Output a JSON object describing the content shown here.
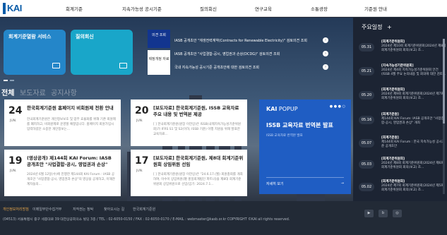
{
  "header": {
    "logo": "KAI",
    "nav": [
      "회계기준",
      "지속가능성 공시기준",
      "질의회신",
      "연구교육",
      "소통광장",
      "기준원 안내"
    ]
  },
  "tiles": [
    {
      "label": "회계기준열람 서비스"
    },
    {
      "label": "질의회신"
    }
  ],
  "consult": {
    "tab_active": "의견 조회",
    "tab_other": "제정개정 자료",
    "rows": [
      "IASB 공개초안 \"재생전력계약(Contracts for Renewable Electricity)\" 검토의견 조회",
      "IASB 공개초안 \"사업결합-공시, 영업권과 손상(DCDG)\" 검토의견 조회",
      "국내 지속가능성 공시기준 공개초안에 대한 검토의견 조회"
    ],
    "arrow": "›"
  },
  "sections": [
    "전체",
    "보도자료",
    "공지사항"
  ],
  "news": [
    {
      "day": "24",
      "month": "JUN.",
      "title": "한국회계기준원 홈페이지 비회원제 전환 안내",
      "body": "한국회계기준원은 개인정보보호 및 업무 효율화를 위해 기존 회원제를 폐지하고, 비회원제로 운영할 예정입니다. 홈페이지 회원가입시 입력하셨던 소중한 개인정보는..."
    },
    {
      "day": "20",
      "month": "JUN.",
      "title": "[보도자료] 한국회계기준원, ISSB 교육자료 주요 내용 및 번역본 제공",
      "body": "[ ] 한국회계기준원(원장 이한상)은 ISSB(국제지속가능성기준위원회)가 IFRS S1 및 S2(이하, ISSB 기준) 이행 지원을 위해 발표한 교육자료..."
    },
    {
      "day": "19",
      "month": "JUN.",
      "title": "(영상공개) 제144회 KAI Forum: IASB 공개초안 \"사업결합-공시, 영업권과 손상\"",
      "body": "2024년 6월 12일(수)에 진행한 제144회 KAI Forum : IASB 공개초안 \"사업결합-공시, 영업권과 손상\"의 영상을 공개하고, 이해관계자들의..."
    },
    {
      "day": "17",
      "month": "JUN.",
      "title": "[보도자료] 한국회계기준원, 제8대 회계기준위원회 상임위원 선임",
      "body": "[ ] 한국회계기준원(원장 이한상)은 \"24.6.17.(월) 회원총회를 개최하여, 이수이 상임위원(現 홍일회계법인 파트너)을 제8대 회계기준위원회 상임위원으로 선임(임기: 2024.7.1..."
    }
  ],
  "popup": {
    "brand": "KAI",
    "brand_suffix": "POPUP",
    "pages": "● ● ● ○",
    "title": "ISSB 교육자료 번역본 발표",
    "subtitle": "ISSB 교육자료 번역본 발표",
    "button": "자세히 보기",
    "arrow": "→"
  },
  "schedule": {
    "title": "주요일정",
    "plus": "+",
    "items": [
      {
        "date": "05.31",
        "title": "[회계기준위원회]",
        "body": "2024년 제10회 회계기준위원회(2024년 제8회 회계기준위원회 회의(보고) 조..."
      },
      {
        "date": "05.21",
        "title": "[지속가능성기준위원회]",
        "body": "2024년 제4회 지속가능성기준위원회 안건 (ISSB 4월 주요 논의내용 및 회의에 대한 검토..."
      },
      {
        "date": "05.20",
        "title": "[회계기준위원회]",
        "body": "2024년 제9회 회계기준위원회(2024년 제7회 회계기준위원회 회의(보고) 조..."
      },
      {
        "date": "05.16",
        "title": "[회계기준원]",
        "body": "제144회 KAI Forum: IASB 공개초안 \"사업결합-공시, 영업권과 손상\" 개최"
      },
      {
        "date": "05.07",
        "title": "[회계기준원]",
        "body": "제144회 KAI Forum : 한국 지속가능성 공시기준 공개초안"
      },
      {
        "date": "05.03",
        "title": "[회계기준위원회]",
        "body": "2024년 제8회 회계기준위원회(2024년 제6회 회계기준위원회 회의(보고) 조..."
      },
      {
        "date": "05.02",
        "title": "[회계기준위원회]",
        "body": "2024년 제7회 회계기준위원회(2024년 제5회 회계기준위원회 회의(보고) 조..."
      }
    ]
  },
  "footer": {
    "links": [
      "개인정보처리방침",
      "이메일무단수집거부",
      "저작권는 청탁",
      "찾아오시는 길",
      "한국회계기준원"
    ],
    "address": "(04513) 서울특별시 중구 세종대로 39 대한상공회의소 빌딩 3층 / TEL : 02-6050-0150 / FAX : 02-6050-0170 / E-MAIL : webmaster@kasb.or.kr COPYRIGHT ©KAI all rights reserved.",
    "icons": [
      "youtube-icon",
      "blog-icon",
      "instagram-icon"
    ],
    "icon_glyphs": [
      "▶",
      "b",
      "◎"
    ]
  }
}
